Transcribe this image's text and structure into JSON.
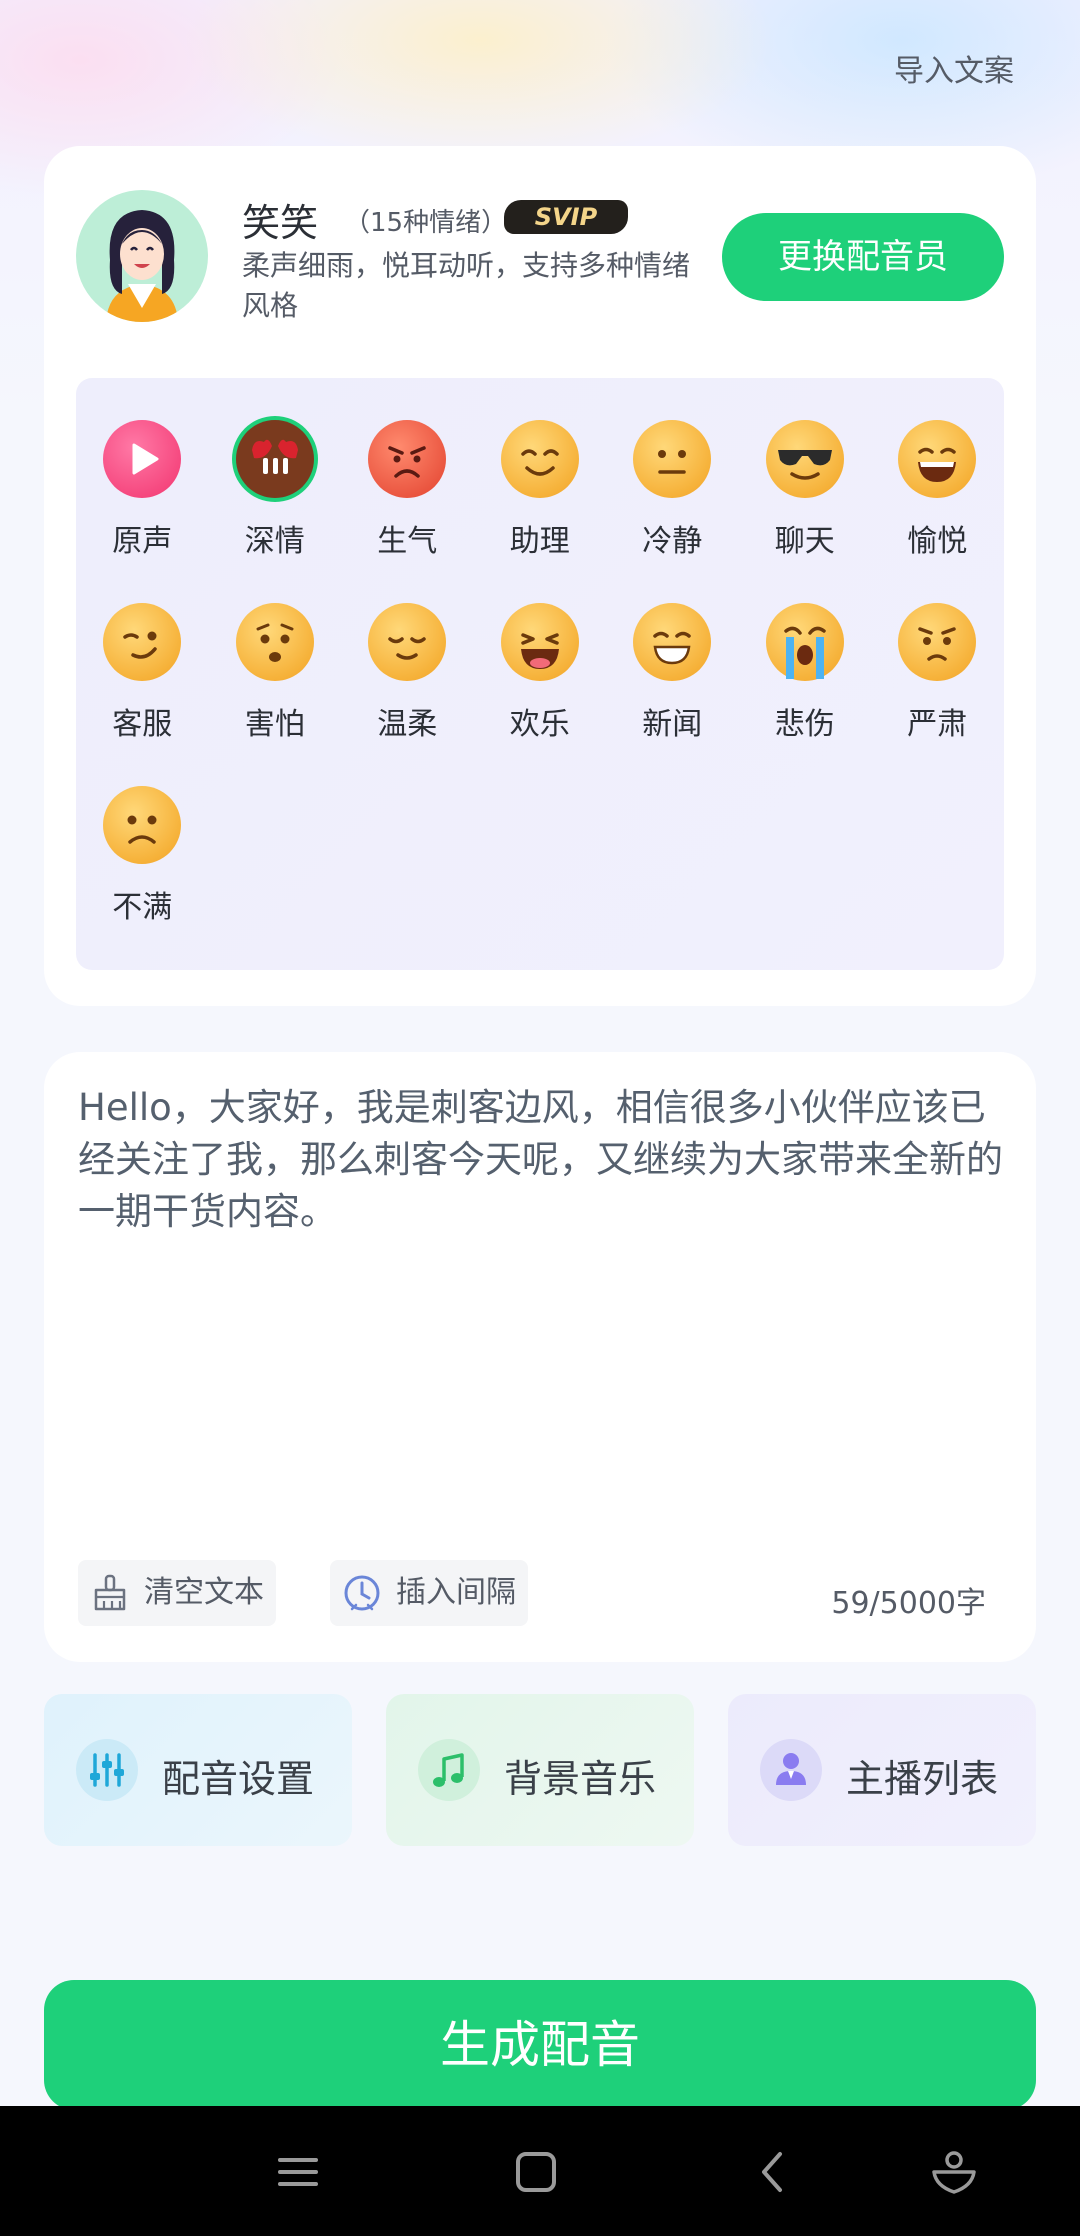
{
  "header": {
    "import_label": "导入文案"
  },
  "voice": {
    "name": "笑笑",
    "emotion_count": "（15种情绪）",
    "badge": "SVIP",
    "description": "柔声细雨，悦耳动听，支持多种情绪风格",
    "change_button": "更换配音员"
  },
  "emotions": [
    {
      "label": "原声",
      "icon": "play-icon"
    },
    {
      "label": "深情",
      "icon": "affectionate-emoji-icon",
      "selected": true
    },
    {
      "label": "生气",
      "icon": "angry-emoji-icon"
    },
    {
      "label": "助理",
      "icon": "smile-emoji-icon"
    },
    {
      "label": "冷静",
      "icon": "neutral-emoji-icon"
    },
    {
      "label": "聊天",
      "icon": "sunglasses-emoji-icon"
    },
    {
      "label": "愉悦",
      "icon": "grin-emoji-icon"
    },
    {
      "label": "客服",
      "icon": "wink-emoji-icon"
    },
    {
      "label": "害怕",
      "icon": "worried-emoji-icon"
    },
    {
      "label": "温柔",
      "icon": "relieved-emoji-icon"
    },
    {
      "label": "欢乐",
      "icon": "laugh-emoji-icon"
    },
    {
      "label": "新闻",
      "icon": "grin-squint-emoji-icon"
    },
    {
      "label": "悲伤",
      "icon": "crying-emoji-icon"
    },
    {
      "label": "严肃",
      "icon": "frown-emoji-icon"
    },
    {
      "label": "不满",
      "icon": "displeased-emoji-icon"
    }
  ],
  "editor": {
    "text": "Hello，大家好，我是刺客边风，相信很多小伙伴应该已经关注了我，那么刺客今天呢，又继续为大家带来全新的一期干货内容。",
    "clear_label": "清空文本",
    "insert_label": "插入间隔",
    "char_count": "59/5000字"
  },
  "features": [
    {
      "label": "配音设置",
      "icon": "sliders-icon"
    },
    {
      "label": "背景音乐",
      "icon": "music-note-icon"
    },
    {
      "label": "主播列表",
      "icon": "person-icon"
    }
  ],
  "generate_label": "生成配音",
  "colors": {
    "accent": "#1ed07a",
    "svip_bg": "#23201c",
    "svip_text": "#f4d58a"
  }
}
